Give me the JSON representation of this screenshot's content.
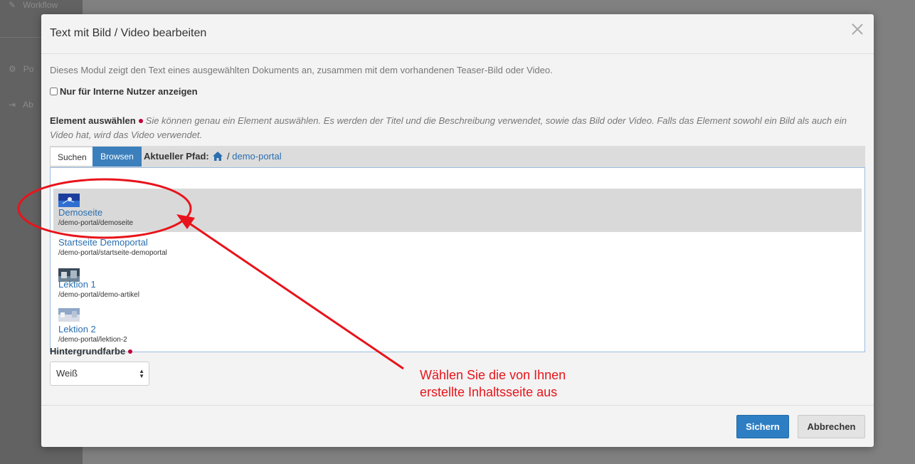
{
  "background": {
    "nav_items": [
      {
        "label": "Workflow",
        "icon": "pencil-icon"
      },
      {
        "label": "Po",
        "icon": "gears-icon"
      },
      {
        "label": "Ab",
        "icon": "logout-icon"
      }
    ]
  },
  "modal": {
    "title": "Text mit Bild / Video bearbeiten",
    "description": "Dieses Modul zeigt den Text eines ausgewählten Dokuments an, zusammen mit dem vorhandenen Teaser-Bild oder Video.",
    "internal_checkbox_label": "Nur für Interne Nutzer anzeigen",
    "element_label": "Element auswählen",
    "element_help": "Sie können genau ein Element auswählen. Es werden der Titel und die Beschreibung verwendet, sowie das Bild oder Video. Falls das Element sowohl ein Bild als auch ein Video hat, wird das Video verwendet.",
    "tabs": {
      "search": "Suchen",
      "browse": "Browsen"
    },
    "path_label": "Aktueller Pfad:",
    "path_sep": "/",
    "path_current": "demo-portal",
    "results": [
      {
        "title": "Demoseite",
        "path": "/demo-portal/demoseite",
        "selected": true
      },
      {
        "title": "Startseite Demoportal",
        "path": "/demo-portal/startseite-demoportal",
        "selected": false
      },
      {
        "title": "Lektion 1",
        "path": "/demo-portal/demo-artikel",
        "selected": false
      },
      {
        "title": "Lektion 2",
        "path": "/demo-portal/lektion-2",
        "selected": false
      }
    ],
    "background_label": "Hintergrundfarbe",
    "background_select_value": "Weiß",
    "buttons": {
      "save": "Sichern",
      "cancel": "Abbrechen"
    }
  },
  "annotation": {
    "line1": "Wählen Sie die von Ihnen",
    "line2": "erstellte Inhaltsseite aus"
  },
  "colors": {
    "accent": "#2e7ec3",
    "link": "#2a6fb0",
    "required": "#c0003a",
    "annotation": "#e8141b"
  }
}
